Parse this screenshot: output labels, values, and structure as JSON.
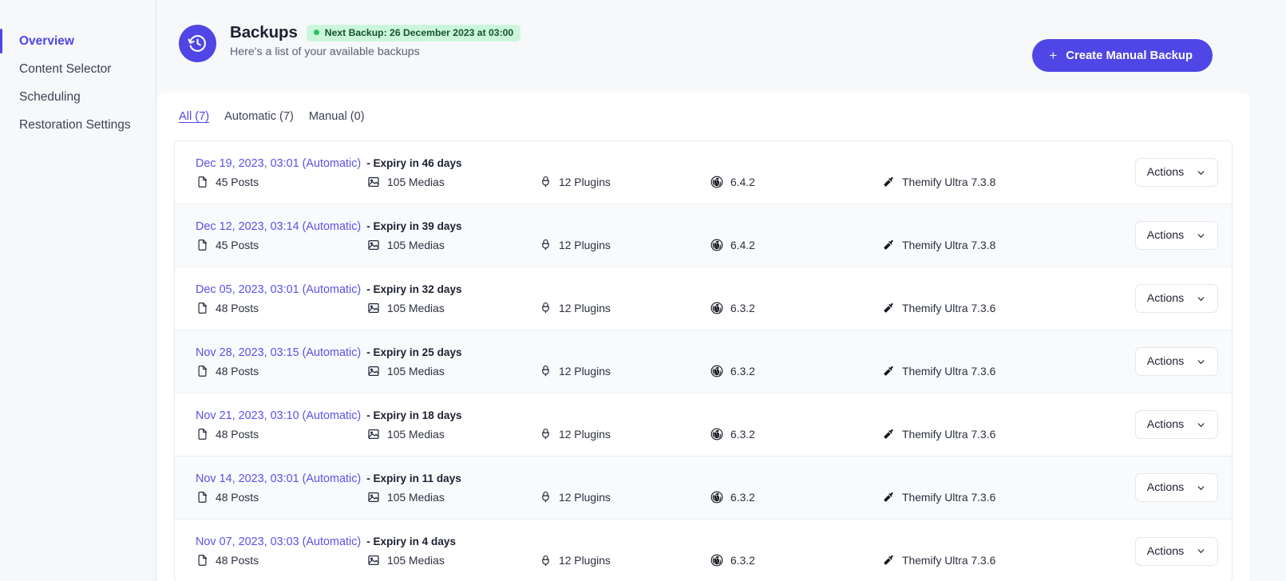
{
  "sidebar": {
    "items": [
      {
        "label": "Overview",
        "active": true
      },
      {
        "label": "Content Selector",
        "active": false
      },
      {
        "label": "Scheduling",
        "active": false
      },
      {
        "label": "Restoration Settings",
        "active": false
      }
    ]
  },
  "header": {
    "icon": "history-clock-icon",
    "title": "Backups",
    "badge": "Next Backup: 26 December 2023 at 03:00",
    "badge_dot_color": "#21c45d",
    "badge_bg_color": "#ccf6dc",
    "subtitle": "Here's a list of your available backups",
    "create_button_label": "Create Manual Backup",
    "create_button_icon": "plus-icon",
    "accent_color": "#4f46e5"
  },
  "tabs": [
    {
      "label": "All (7)",
      "active": true
    },
    {
      "label": "Automatic (7)",
      "active": false
    },
    {
      "label": "Manual (0)",
      "active": false
    }
  ],
  "actions_label": "Actions",
  "backups": [
    {
      "date": "Dec 19, 2023, 03:01 (Automatic)",
      "expiry": "- Expiry in 46 days",
      "posts": "45 Posts",
      "medias": "105 Medias",
      "plugins": "12 Plugins",
      "wordpress": "6.4.2",
      "theme": "Themify Ultra 7.3.8"
    },
    {
      "date": "Dec 12, 2023, 03:14 (Automatic)",
      "expiry": "- Expiry in 39 days",
      "posts": "45 Posts",
      "medias": "105 Medias",
      "plugins": "12 Plugins",
      "wordpress": "6.4.2",
      "theme": "Themify Ultra 7.3.8"
    },
    {
      "date": "Dec 05, 2023, 03:01 (Automatic)",
      "expiry": "- Expiry in 32 days",
      "posts": "48 Posts",
      "medias": "105 Medias",
      "plugins": "12 Plugins",
      "wordpress": "6.3.2",
      "theme": "Themify Ultra 7.3.6"
    },
    {
      "date": "Nov 28, 2023, 03:15 (Automatic)",
      "expiry": "- Expiry in 25 days",
      "posts": "48 Posts",
      "medias": "105 Medias",
      "plugins": "12 Plugins",
      "wordpress": "6.3.2",
      "theme": "Themify Ultra 7.3.6"
    },
    {
      "date": "Nov 21, 2023, 03:10 (Automatic)",
      "expiry": "- Expiry in 18 days",
      "posts": "48 Posts",
      "medias": "105 Medias",
      "plugins": "12 Plugins",
      "wordpress": "6.3.2",
      "theme": "Themify Ultra 7.3.6"
    },
    {
      "date": "Nov 14, 2023, 03:01 (Automatic)",
      "expiry": "- Expiry in 11 days",
      "posts": "48 Posts",
      "medias": "105 Medias",
      "plugins": "12 Plugins",
      "wordpress": "6.3.2",
      "theme": "Themify Ultra 7.3.6"
    },
    {
      "date": "Nov 07, 2023, 03:03 (Automatic)",
      "expiry": "- Expiry in 4 days",
      "posts": "48 Posts",
      "medias": "105 Medias",
      "plugins": "12 Plugins",
      "wordpress": "6.3.2",
      "theme": "Themify Ultra 7.3.6"
    }
  ]
}
